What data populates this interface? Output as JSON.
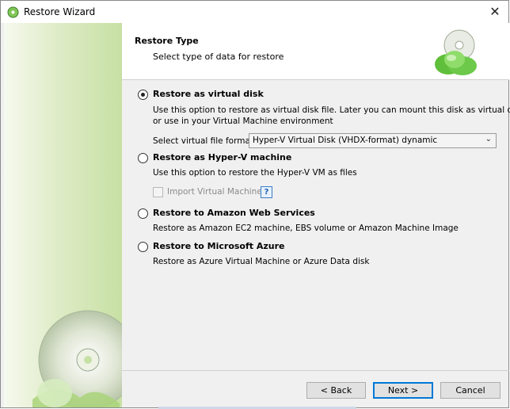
{
  "window": {
    "title": "Restore Wizard",
    "close_glyph": "✕"
  },
  "header": {
    "title": "Restore Type",
    "subtitle": "Select type of data for restore",
    "icon": "cd-cloud-icon"
  },
  "options": [
    {
      "label": "Restore as virtual disk",
      "selected": true,
      "description_lines": [
        "Use this option to restore as virtual disk file. Later you can mount this disk as virtual drive",
        "or use in your Virtual Machine environment"
      ]
    },
    {
      "label": "Restore as Hyper-V machine",
      "selected": false,
      "description_lines": [
        "Use this option to restore the Hyper-V VM as files"
      ]
    },
    {
      "label": "Restore to Amazon Web Services",
      "selected": false,
      "description_lines": [
        "Restore as Amazon EC2 machine, EBS volume or Amazon Machine Image"
      ]
    },
    {
      "label": "Restore to Microsoft Azure",
      "selected": false,
      "description_lines": [
        "Restore as Azure Virtual Machine or Azure Data disk"
      ]
    }
  ],
  "format": {
    "label": "Select virtual file format:",
    "value": "Hyper-V Virtual Disk (VHDX-format) dynamic"
  },
  "import_vm": {
    "label": "Import Virtual Machine",
    "checked": false,
    "enabled": false,
    "help_glyph": "?"
  },
  "buttons": {
    "back": "< Back",
    "next": "Next >",
    "cancel": "Cancel"
  },
  "colors": {
    "accent": "#0078d7",
    "side_panel": "#c7e0a4"
  }
}
